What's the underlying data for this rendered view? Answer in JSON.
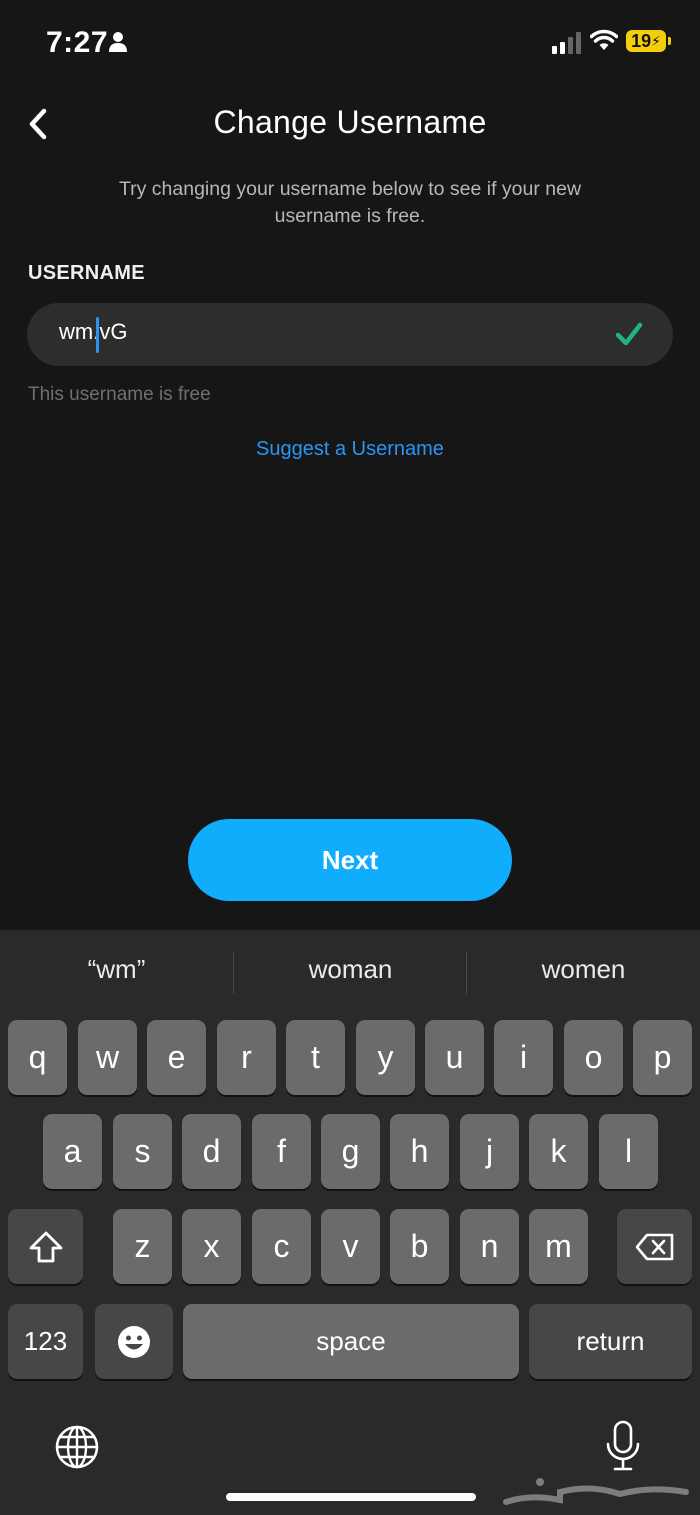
{
  "status_bar": {
    "time": "7:27",
    "battery": "19"
  },
  "header": {
    "title": "Change Username"
  },
  "subtitle": "Try changing your username below to see if your new username is free.",
  "username": {
    "label": "USERNAME",
    "value": "wm.vG",
    "status": "This username is free"
  },
  "suggest_label": "Suggest a Username",
  "next_label": "Next",
  "keyboard": {
    "suggestions": [
      "“wm”",
      "woman",
      "women"
    ],
    "row1": [
      "q",
      "w",
      "e",
      "r",
      "t",
      "y",
      "u",
      "i",
      "o",
      "p"
    ],
    "row2": [
      "a",
      "s",
      "d",
      "f",
      "g",
      "h",
      "j",
      "k",
      "l"
    ],
    "row3": [
      "z",
      "x",
      "c",
      "v",
      "b",
      "n",
      "m"
    ],
    "numbers_label": "123",
    "space_label": "space",
    "return_label": "return"
  },
  "colors": {
    "accent": "#0fadfb",
    "link": "#2a95f3",
    "check": "#1fb580",
    "background": "#161616"
  }
}
